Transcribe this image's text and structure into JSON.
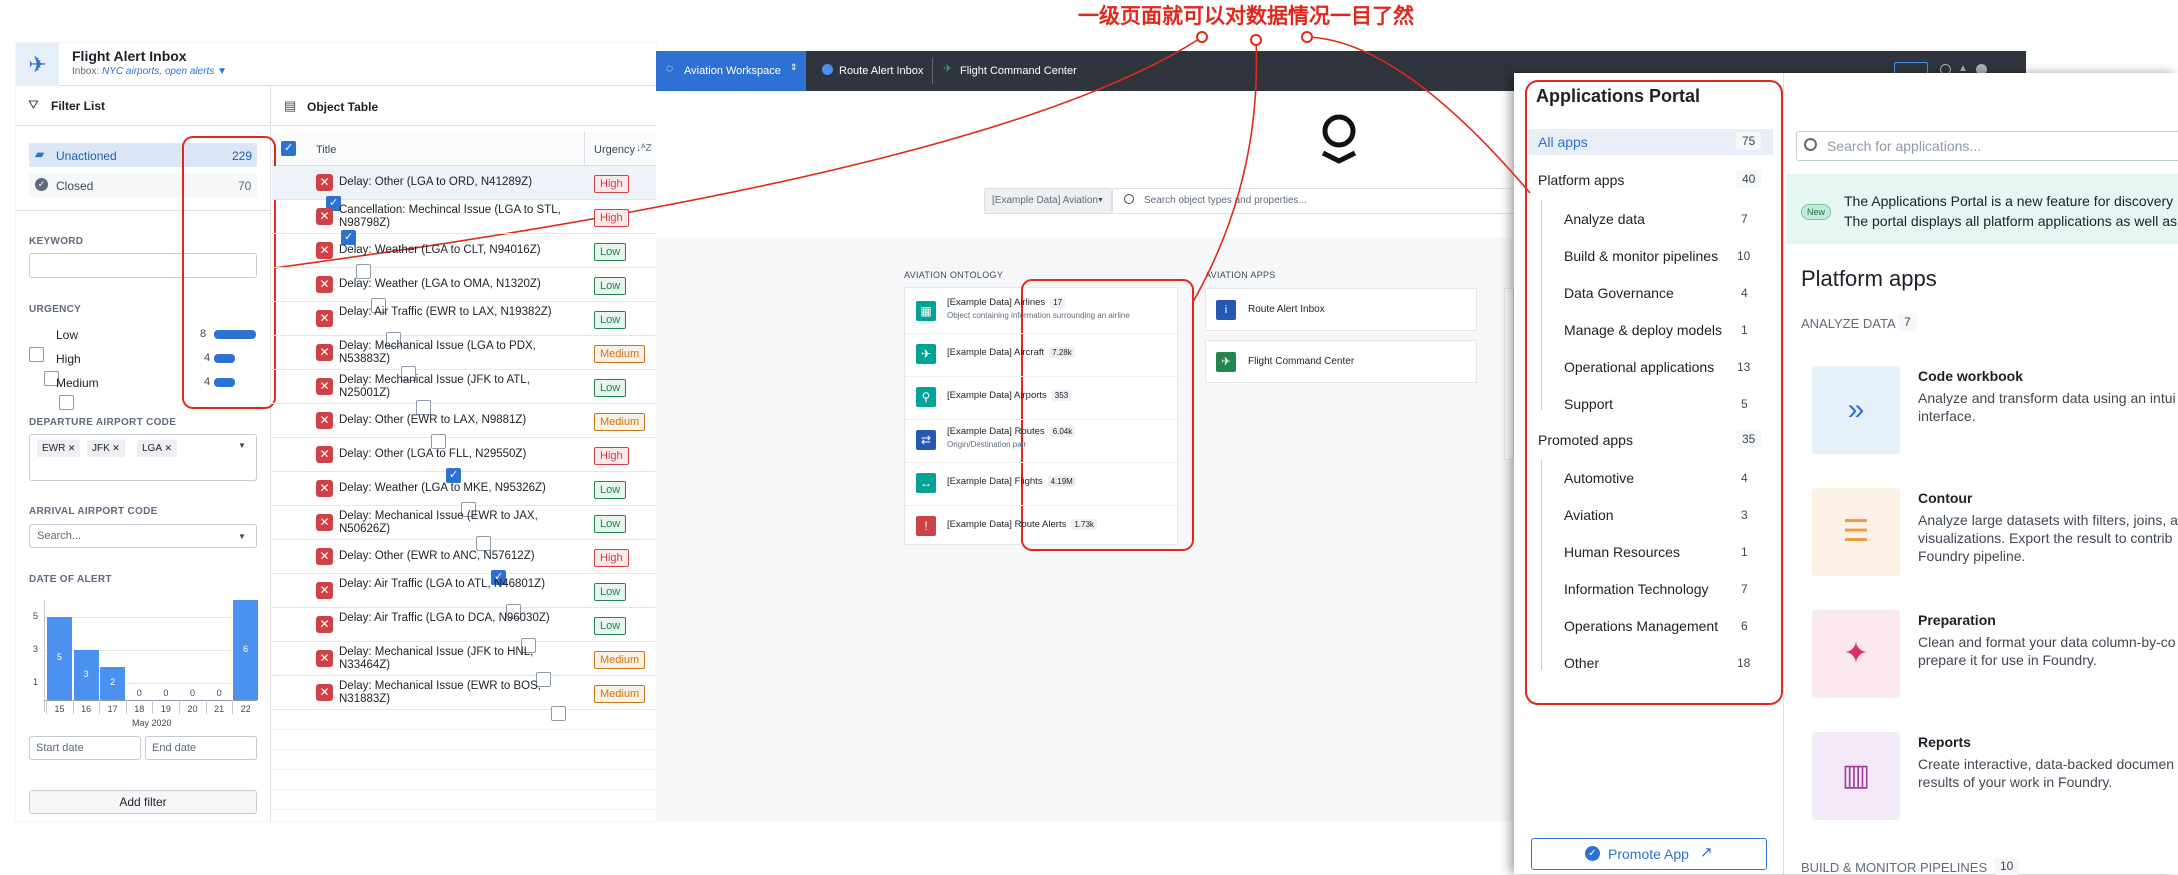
{
  "annotation": {
    "text": "一级页面就可以对数据情况一目了然"
  },
  "left": {
    "app_title": "Flight Alert Inbox",
    "inbox_prefix": "Inbox: ",
    "inbox_value": "NYC airports, open alerts",
    "filter_title": "Filter List",
    "unactioned_label": "Unactioned",
    "unactioned_count": "229",
    "closed_label": "Closed",
    "closed_count": "70",
    "keyword_label": "KEYWORD",
    "urgency_label": "URGENCY",
    "urgency": [
      {
        "label": "Low",
        "count": "8",
        "frac": 1.0
      },
      {
        "label": "High",
        "count": "4",
        "frac": 0.5
      },
      {
        "label": "Medium",
        "count": "4",
        "frac": 0.5
      }
    ],
    "departure_label": "DEPARTURE AIRPORT CODE",
    "departure_tags": [
      "EWR",
      "JFK",
      "LGA"
    ],
    "arrival_label": "ARRIVAL AIRPORT CODE",
    "arrival_placeholder": "Search...",
    "date_label": "DATE OF ALERT",
    "start_placeholder": "Start date",
    "end_placeholder": "End date",
    "add_filter": "Add filter"
  },
  "chart_data": {
    "type": "bar",
    "categories": [
      "15",
      "16",
      "17",
      "18",
      "19",
      "20",
      "21",
      "22"
    ],
    "values": [
      5,
      3,
      2,
      0,
      0,
      0,
      0,
      6
    ],
    "xlabel": "May 2020",
    "yticks": [
      "5",
      "3",
      "1"
    ],
    "ylim": [
      0,
      6
    ]
  },
  "table": {
    "title": "Object Table",
    "col_title": "Title",
    "col_urgency": "Urgency",
    "sort_glyph": "↓ᴬZ",
    "rows": [
      {
        "title": "Delay: Other (LGA to ORD, N41289Z)",
        "urgency": "High",
        "checked": true
      },
      {
        "title": "Cancellation: Mechincal Issue (LGA to STL, N98798Z)",
        "urgency": "High",
        "checked": true
      },
      {
        "title": "Delay: Weather (LGA to CLT, N94016Z)",
        "urgency": "Low",
        "checked": false
      },
      {
        "title": "Delay: Weather (LGA to OMA, N1320Z)",
        "urgency": "Low",
        "checked": false
      },
      {
        "title": "Delay: Air Traffic (EWR to LAX, N19382Z)",
        "urgency": "Low",
        "checked": false
      },
      {
        "title": "Delay: Mechanical Issue (LGA to PDX, N53883Z)",
        "urgency": "Medium",
        "checked": false
      },
      {
        "title": "Delay: Mechanical Issue (JFK to ATL, N25001Z)",
        "urgency": "Low",
        "checked": false
      },
      {
        "title": "Delay: Other (EWR to LAX, N9881Z)",
        "urgency": "Medium",
        "checked": false
      },
      {
        "title": "Delay: Other (LGA to FLL, N29550Z)",
        "urgency": "High",
        "checked": true
      },
      {
        "title": "Delay: Weather (LGA to MKE, N95326Z)",
        "urgency": "Low",
        "checked": false
      },
      {
        "title": "Delay: Mechanical Issue (EWR to JAX, N50626Z)",
        "urgency": "Low",
        "checked": false
      },
      {
        "title": "Delay: Other (EWR to ANC, N57612Z)",
        "urgency": "High",
        "checked": true
      },
      {
        "title": "Delay: Air Traffic (LGA to ATL, N46801Z)",
        "urgency": "Low",
        "checked": false
      },
      {
        "title": "Delay: Air Traffic (LGA to DCA, N96030Z)",
        "urgency": "Low",
        "checked": false
      },
      {
        "title": "Delay: Mechanical Issue (JFK to HNL, N33464Z)",
        "urgency": "Medium",
        "checked": false
      },
      {
        "title": "Delay: Mechanical Issue (EWR to BOS, N31883Z)",
        "urgency": "Medium",
        "checked": false
      }
    ]
  },
  "workspace": {
    "tabs": [
      {
        "label": "Aviation Workspace"
      },
      {
        "label": "Route Alert Inbox"
      },
      {
        "label": "Flight Command Center"
      }
    ],
    "search_scope": "[Example Data] Aviation",
    "search_placeholder": "Search object types and properties...",
    "ontology_title": "AVIATION ONTOLOGY",
    "apps_title": "AVIATION APPS",
    "ontology": [
      {
        "name": "[Example Data] Airlines",
        "count": "17",
        "desc": "Object containing information surrounding an airline",
        "color": "#00a396",
        "glyph": "▦"
      },
      {
        "name": "[Example Data] Aircraft",
        "count": "7.28k",
        "desc": "",
        "color": "#00a396",
        "glyph": "✈"
      },
      {
        "name": "[Example Data] Airports",
        "count": "353",
        "desc": "",
        "color": "#00a396",
        "glyph": "⚲"
      },
      {
        "name": "[Example Data] Routes",
        "count": "6.04k",
        "desc": "Origin/Destination pair",
        "color": "#2458b3",
        "glyph": "⇄"
      },
      {
        "name": "[Example Data] Flights",
        "count": "4.19M",
        "desc": "",
        "color": "#00a396",
        "glyph": "↔"
      },
      {
        "name": "[Example Data] Route Alerts",
        "count": "1.73k",
        "desc": "",
        "color": "#cd4246",
        "glyph": "!"
      }
    ],
    "apps": [
      {
        "label": "Route Alert Inbox",
        "color": "#2458b3",
        "glyph": "i"
      },
      {
        "label": "Flight Command Center",
        "color": "#238551",
        "glyph": "✈"
      }
    ]
  },
  "portal": {
    "title": "Applications Portal",
    "search_placeholder": "Search for applications...",
    "new_badge": "New",
    "banner_line1": "The Applications Portal is a new feature for discovery",
    "banner_line2": "The portal displays all platform applications as well as",
    "all_apps": {
      "label": "All apps",
      "count": "75"
    },
    "platform_apps": {
      "label": "Platform apps",
      "count": "40"
    },
    "platform_items": [
      {
        "label": "Analyze data",
        "count": "7"
      },
      {
        "label": "Build & monitor pipelines",
        "count": "10"
      },
      {
        "label": "Data Governance",
        "count": "4"
      },
      {
        "label": "Manage & deploy models",
        "count": "1"
      },
      {
        "label": "Operational applications",
        "count": "13"
      },
      {
        "label": "Support",
        "count": "5"
      }
    ],
    "promoted_apps": {
      "label": "Promoted apps",
      "count": "35"
    },
    "promoted_items": [
      {
        "label": "Automotive",
        "count": "4"
      },
      {
        "label": "Aviation",
        "count": "3"
      },
      {
        "label": "Human Resources",
        "count": "1"
      },
      {
        "label": "Information Technology",
        "count": "7"
      },
      {
        "label": "Operations Management",
        "count": "6"
      },
      {
        "label": "Other",
        "count": "18"
      }
    ],
    "promote_button": "Promote App",
    "main_title": "Platform apps",
    "analyze_label": "ANALYZE DATA",
    "analyze_count": "7",
    "cards": [
      {
        "title": "Code workbook",
        "lines": [
          "Analyze and transform data using an intui",
          "interface."
        ],
        "bg": "#e6f1fb",
        "fg": "#2d72d2",
        "glyph": "»"
      },
      {
        "title": "Contour",
        "lines": [
          "Analyze large datasets with filters, joins, a",
          "visualizations. Export the result to contrib",
          "Foundry pipeline."
        ],
        "bg": "#fdf1e6",
        "fg": "#ec9a3c",
        "glyph": "☰"
      },
      {
        "title": "Preparation",
        "lines": [
          "Clean and format your data column-by-co",
          "prepare it for use in Foundry."
        ],
        "bg": "#fbe9ef",
        "fg": "#db2c6f",
        "glyph": "✦"
      },
      {
        "title": "Reports",
        "lines": [
          "Create interactive, data-backed documen",
          "results of your work in Foundry."
        ],
        "bg": "#f3e9f6",
        "fg": "#9d3f9d",
        "glyph": "▥"
      }
    ],
    "build_label": "BUILD & MONITOR PIPELINES",
    "build_count": "10"
  }
}
